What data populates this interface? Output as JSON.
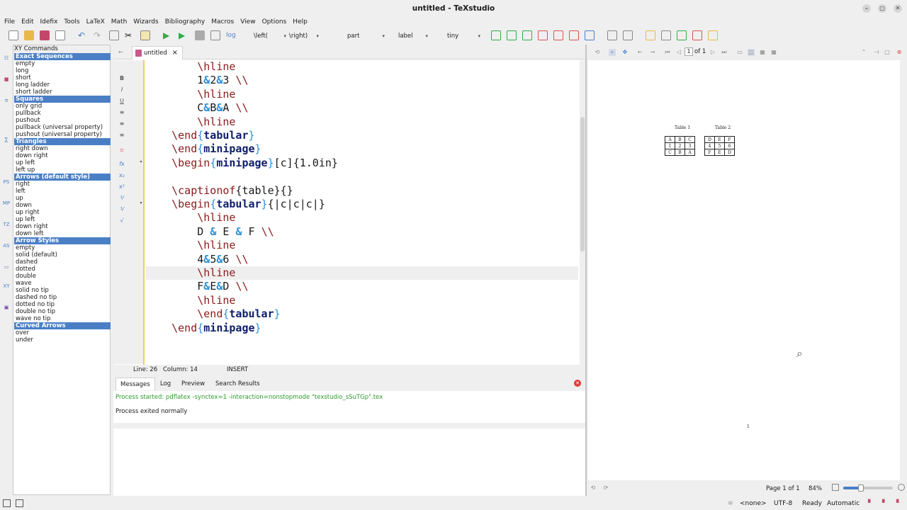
{
  "window": {
    "title": "untitled - TeXstudio"
  },
  "menu": [
    "File",
    "Edit",
    "Idefix",
    "Tools",
    "LaTeX",
    "Math",
    "Wizards",
    "Bibliography",
    "Macros",
    "View",
    "Options",
    "Help"
  ],
  "toolbar": {
    "left_label": "\\left(",
    "right_label": "\\right)",
    "part_label": "part",
    "label_label": "label",
    "size_label": "tiny"
  },
  "sidepanel": {
    "title": "XY Commands",
    "items": [
      {
        "t": "Exact Sequences",
        "h": 1
      },
      {
        "t": "empty"
      },
      {
        "t": "long"
      },
      {
        "t": "short"
      },
      {
        "t": "long ladder"
      },
      {
        "t": "short ladder"
      },
      {
        "t": "Squares",
        "h": 1
      },
      {
        "t": "only grid"
      },
      {
        "t": "pullback"
      },
      {
        "t": "pushout"
      },
      {
        "t": "pullback (universal property)"
      },
      {
        "t": "pushout (universal property)"
      },
      {
        "t": "Triangles",
        "h": 1
      },
      {
        "t": "right down"
      },
      {
        "t": "down right"
      },
      {
        "t": "up left"
      },
      {
        "t": "left up"
      },
      {
        "t": "Arrows (default style)",
        "h": 1
      },
      {
        "t": "right"
      },
      {
        "t": "left"
      },
      {
        "t": "up"
      },
      {
        "t": "down"
      },
      {
        "t": "up right"
      },
      {
        "t": "up left"
      },
      {
        "t": "down right"
      },
      {
        "t": "down left"
      },
      {
        "t": "Arrow Styles",
        "h": 1
      },
      {
        "t": "empty"
      },
      {
        "t": "solid (default)"
      },
      {
        "t": "dashed"
      },
      {
        "t": "dotted"
      },
      {
        "t": "double"
      },
      {
        "t": "wave"
      },
      {
        "t": "solid no tip"
      },
      {
        "t": "dashed no tip"
      },
      {
        "t": "dotted no tip"
      },
      {
        "t": "double no tip"
      },
      {
        "t": "wave no tip"
      },
      {
        "t": "Curved Arrows",
        "h": 1
      },
      {
        "t": "over"
      },
      {
        "t": "under"
      }
    ]
  },
  "editor": {
    "tab_name": "untitled",
    "lines": [
      "        \\hline",
      "        1&2&3 \\\\",
      "        \\hline",
      "        C&B&A \\\\",
      "        \\hline",
      "    \\end{tabular}",
      "    \\end{minipage}",
      "    \\begin{minipage}[c]{1.0in}",
      "",
      "    \\captionof{table}{}",
      "    \\begin{tabular}{|c|c|c|}",
      "        \\hline",
      "        D & E & F \\\\",
      "        \\hline",
      "        4&5&6 \\\\",
      "        \\hline",
      "        F&E&D \\\\",
      "        \\hline",
      "        \\end{tabular}",
      "    \\end{minipage}"
    ],
    "current_line_index": 15,
    "status": {
      "line": "Line: 26",
      "column": "Column: 14",
      "mode": "INSERT"
    }
  },
  "messages": {
    "tabs": [
      "Messages",
      "Log",
      "Preview",
      "Search Results"
    ],
    "line1": "Process started: pdflatex -synctex=1 -interaction=nonstopmode \"texstudio_sSuTGp\".tex",
    "line2": "Process exited normally"
  },
  "preview": {
    "page_input": "1",
    "page_of": "of 1",
    "table1_caption": "Table 1",
    "table2_caption": "Table 2",
    "table1": [
      [
        "A",
        "B",
        "C"
      ],
      [
        "1",
        "2",
        "3"
      ],
      [
        "C",
        "B",
        "A"
      ]
    ],
    "table2": [
      [
        "D",
        "E",
        "F"
      ],
      [
        "4",
        "5",
        "6"
      ],
      [
        "F",
        "E",
        "D"
      ]
    ],
    "page_number": "1",
    "page_status": "Page 1 of 1",
    "zoom": "84%",
    "zoom_fraction": 0.35
  },
  "statusbar": {
    "lang": "<none>",
    "encoding": "UTF-8",
    "state": "Ready",
    "mode": "Automatic"
  },
  "colors": {
    "accent": "#4a7fc6",
    "keyword": "#8b1a1a",
    "brace": "#2d8fd6",
    "env": "#0d1d6b"
  }
}
